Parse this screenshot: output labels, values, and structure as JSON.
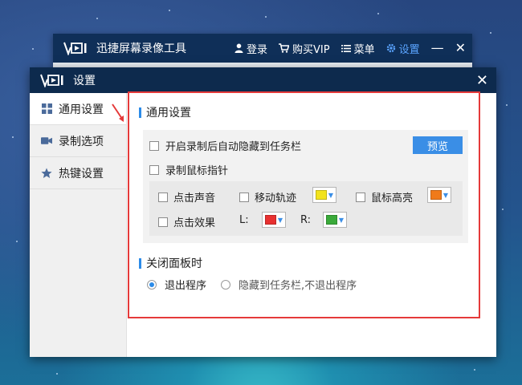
{
  "main_window": {
    "app_title": "迅捷屏幕录像工具",
    "actions": [
      {
        "icon": "user-icon",
        "label": "登录"
      },
      {
        "icon": "cart-icon",
        "label": "购买VIP"
      },
      {
        "icon": "menu-icon",
        "label": "菜单"
      },
      {
        "icon": "gear-icon",
        "label": "设置"
      }
    ]
  },
  "dialog": {
    "title": "设置",
    "sidebar": [
      {
        "icon": "grid-icon",
        "label": "通用设置",
        "active": true
      },
      {
        "icon": "video-camera-icon",
        "label": "录制选项",
        "active": false
      },
      {
        "icon": "star-icon",
        "label": "热键设置",
        "active": false
      }
    ],
    "general": {
      "heading": "通用设置",
      "auto_hide_label": "开启录制后自动隐藏到任务栏",
      "auto_hide_checked": false,
      "preview_button": "预览",
      "record_cursor_label": "录制鼠标指针",
      "record_cursor_checked": false,
      "click_sound_label": "点击声音",
      "move_track_label": "移动轨迹",
      "move_track_color": "#f2e31d",
      "cursor_highlight_label": "鼠标高亮",
      "cursor_highlight_color": "#f07a1a",
      "click_effect_label": "点击效果",
      "left_label": "L:",
      "left_color": "#e83030",
      "right_label": "R:",
      "right_color": "#3aaa3a"
    },
    "close_panel": {
      "heading": "关闭面板时",
      "options": [
        {
          "label": "退出程序",
          "checked": true
        },
        {
          "label": "隐藏到任务栏,不退出程序",
          "checked": false
        }
      ]
    }
  },
  "colors": {
    "accent": "#2c8be8",
    "highlight_border": "#e53a3a",
    "title_bar": "#0d2a4d"
  }
}
